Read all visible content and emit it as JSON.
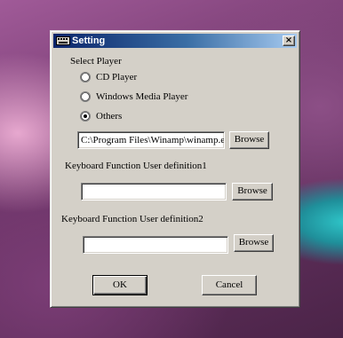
{
  "window": {
    "title": "Setting",
    "close_label": "×"
  },
  "select_player": {
    "label": "Select Player",
    "options": [
      {
        "label": "CD Player",
        "selected": false
      },
      {
        "label": "Windows Media Player",
        "selected": false
      },
      {
        "label": "Others",
        "selected": true
      }
    ],
    "path_value": "C:\\Program Files\\Winamp\\winamp.ex",
    "browse_label": "Browse"
  },
  "keyboard1": {
    "label": "Keyboard Function User definition1",
    "value": "",
    "browse_label": "Browse"
  },
  "keyboard2": {
    "label": "Keyboard Function User definition2",
    "value": "",
    "browse_label": "Browse"
  },
  "buttons": {
    "ok_label": "OK",
    "cancel_label": "Cancel"
  },
  "colors": {
    "titlebar_start": "#0a246a",
    "titlebar_end": "#a6caf0",
    "dialog_face": "#d4d0c8"
  }
}
